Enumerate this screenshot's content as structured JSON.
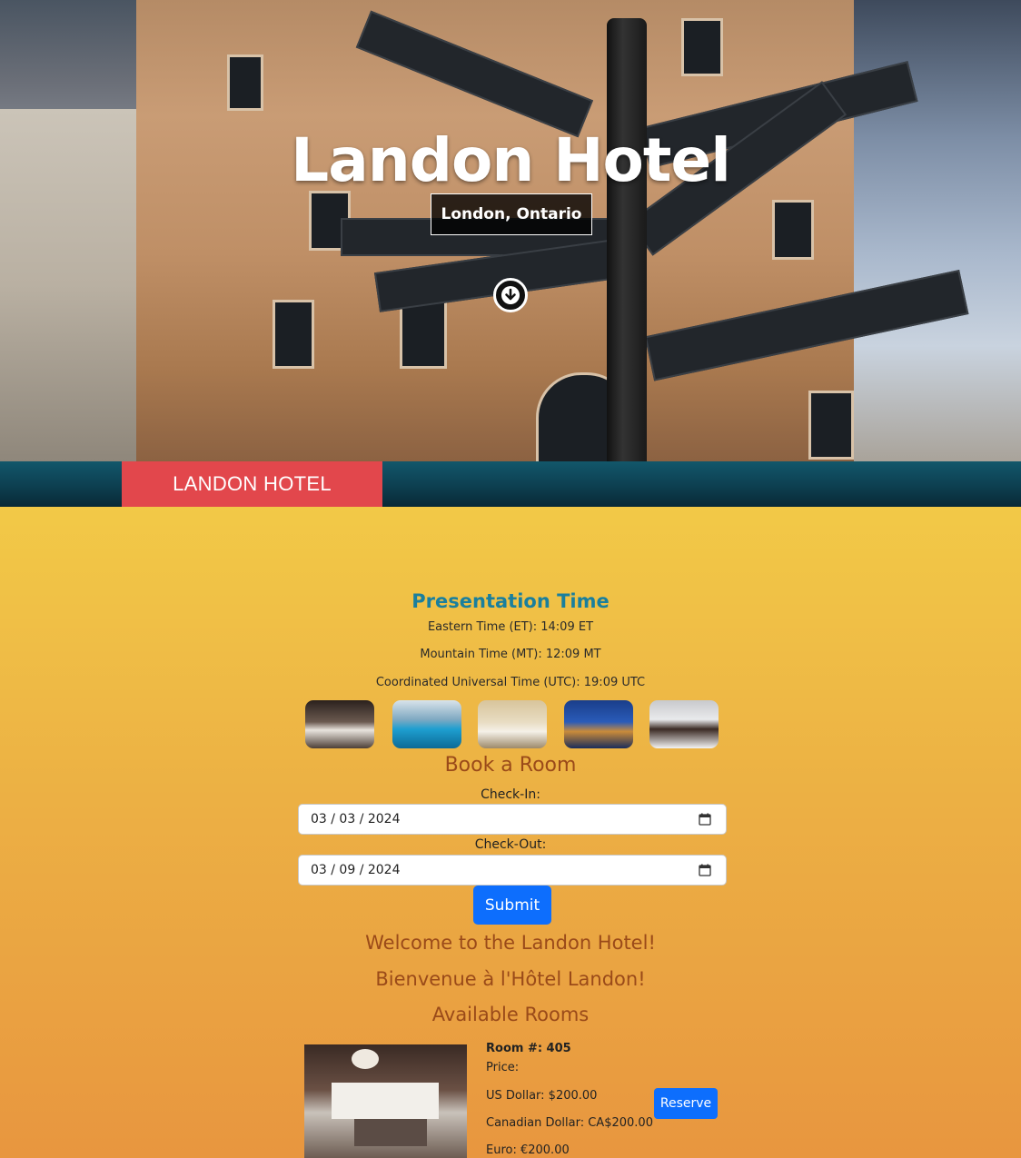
{
  "hero": {
    "title": "Landon Hotel",
    "subtitle": "London, Ontario"
  },
  "nav": {
    "brand": "LANDON HOTEL"
  },
  "presentation": {
    "title": "Presentation Time",
    "times": [
      "Eastern Time (ET): 14:09 ET",
      "Mountain Time (MT): 12:09 MT",
      "Coordinated Universal Time (UTC): 19:09 UTC"
    ]
  },
  "gallery": [
    "bedroom",
    "pool",
    "dining-hall",
    "parliament-night",
    "wedding"
  ],
  "booking": {
    "title": "Book a Room",
    "checkin_label": "Check-In:",
    "checkin_value": "03 / 03 / 2024",
    "checkout_label": "Check-Out:",
    "checkout_value": "03 / 09 / 2024",
    "submit_label": "Submit"
  },
  "welcome": {
    "english": "Welcome to the Landon Hotel!",
    "french": "Bienvenue à l'Hôtel Landon!",
    "rooms_title": "Available Rooms"
  },
  "room": {
    "number": "Room #: 405",
    "price_label": "Price:",
    "usd": "US Dollar: $200.00",
    "cad": "Canadian Dollar: CA$200.00",
    "eur": "Euro: €200.00",
    "reserve_label": "Reserve"
  },
  "colors": {
    "brand_red": "#e2474c",
    "nav_teal": "#0d3f50",
    "accent_blue": "#0d6efd",
    "title_teal": "#1a7f9d",
    "heading_brown": "#9a4a19"
  }
}
